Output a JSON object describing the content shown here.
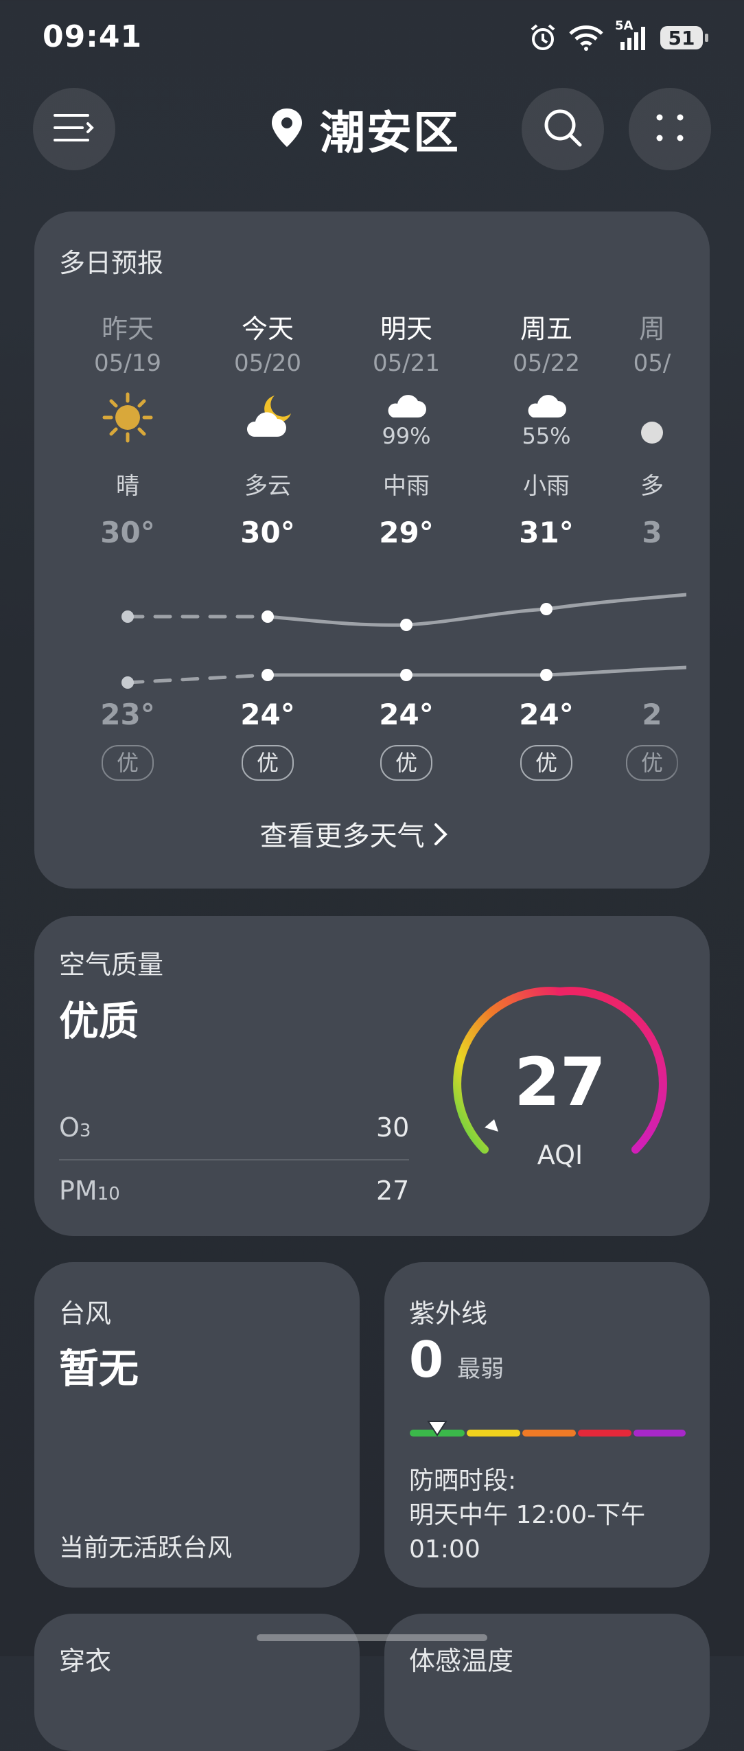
{
  "status": {
    "time": "09:41",
    "network": "5A",
    "battery": "51"
  },
  "header": {
    "location": "潮安区"
  },
  "forecast": {
    "title": "多日预报",
    "days": [
      {
        "name": "昨天",
        "date": "05/19",
        "icon": "sun-icon",
        "precip": "",
        "cond": "晴",
        "high": "30°",
        "low": "23°",
        "aqi": "优"
      },
      {
        "name": "今天",
        "date": "05/20",
        "icon": "partly-cloudy-night-icon",
        "precip": "",
        "cond": "多云",
        "high": "30°",
        "low": "24°",
        "aqi": "优"
      },
      {
        "name": "明天",
        "date": "05/21",
        "icon": "rain-icon",
        "precip": "99%",
        "cond": "中雨",
        "high": "29°",
        "low": "24°",
        "aqi": "优"
      },
      {
        "name": "周五",
        "date": "05/22",
        "icon": "light-rain-icon",
        "precip": "55%",
        "cond": "小雨",
        "high": "31°",
        "low": "24°",
        "aqi": "优"
      },
      {
        "name": "周",
        "date": "05/",
        "icon": "cloud-icon",
        "precip": "",
        "cond": "多",
        "high": "3",
        "low": "2",
        "aqi": "优"
      }
    ],
    "more_label": "查看更多天气"
  },
  "air_quality": {
    "title": "空气质量",
    "level": "优质",
    "pollutants": [
      {
        "name": "O",
        "sub": "3",
        "value": "30"
      },
      {
        "name": "PM",
        "sub": "10",
        "value": "27"
      }
    ],
    "aqi": "27",
    "aqi_label": "AQI"
  },
  "typhoon": {
    "title": "台风",
    "status": "暂无",
    "note": "当前无活跃台风"
  },
  "uv": {
    "title": "紫外线",
    "index": "0",
    "level": "最弱",
    "protect_label": "防晒时段:",
    "protect_time": "明天中午 12:00-下午 01:00",
    "colors": [
      "#3bb84a",
      "#f0d21d",
      "#ef7a26",
      "#e5283a",
      "#a828c9"
    ]
  },
  "bottom_cards": {
    "left_title": "穿衣",
    "right_title": "体感温度"
  }
}
